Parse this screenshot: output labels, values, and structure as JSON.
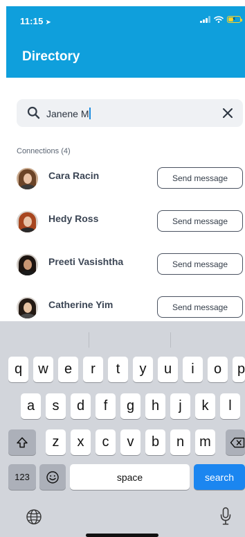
{
  "status_bar": {
    "time": "11:15",
    "battery_color": "#ffd428"
  },
  "header": {
    "title": "Directory",
    "background": "#0f9fdc"
  },
  "search": {
    "value": "Janene M"
  },
  "connections": {
    "label": "Connections (4)",
    "items": [
      {
        "name": "Cara Racin",
        "action": "Send message"
      },
      {
        "name": "Hedy Ross",
        "action": "Send message"
      },
      {
        "name": "Preeti Vasishtha",
        "action": "Send message"
      },
      {
        "name": "Catherine Yim",
        "action": "Send message"
      }
    ]
  },
  "keyboard": {
    "row1": [
      "q",
      "w",
      "e",
      "r",
      "t",
      "y",
      "u",
      "i",
      "o",
      "p"
    ],
    "row2": [
      "a",
      "s",
      "d",
      "f",
      "g",
      "h",
      "j",
      "k",
      "l"
    ],
    "row3": [
      "z",
      "x",
      "c",
      "v",
      "b",
      "n",
      "m"
    ],
    "numbers_key": "123",
    "space_key": "space",
    "search_key": "search",
    "accent": "#1b86f0"
  }
}
